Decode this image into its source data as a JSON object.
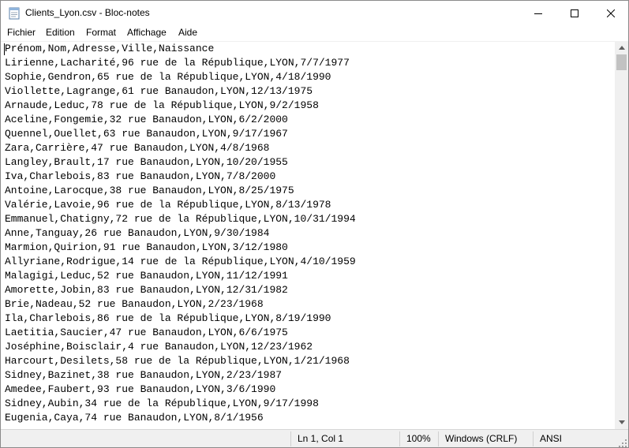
{
  "window": {
    "title": "Clients_Lyon.csv - Bloc-notes"
  },
  "menu": [
    "Fichier",
    "Edition",
    "Format",
    "Affichage",
    "Aide"
  ],
  "editor": {
    "lines": [
      "Prénom,Nom,Adresse,Ville,Naissance",
      "Lirienne,Lacharité,96 rue de la République,LYON,7/7/1977",
      "Sophie,Gendron,65 rue de la République,LYON,4/18/1990",
      "Viollette,Lagrange,61 rue Banaudon,LYON,12/13/1975",
      "Arnaude,Leduc,78 rue de la République,LYON,9/2/1958",
      "Aceline,Fongemie,32 rue Banaudon,LYON,6/2/2000",
      "Quennel,Ouellet,63 rue Banaudon,LYON,9/17/1967",
      "Zara,Carrière,47 rue Banaudon,LYON,4/8/1968",
      "Langley,Brault,17 rue Banaudon,LYON,10/20/1955",
      "Iva,Charlebois,83 rue Banaudon,LYON,7/8/2000",
      "Antoine,Larocque,38 rue Banaudon,LYON,8/25/1975",
      "Valérie,Lavoie,96 rue de la République,LYON,8/13/1978",
      "Emmanuel,Chatigny,72 rue de la République,LYON,10/31/1994",
      "Anne,Tanguay,26 rue Banaudon,LYON,9/30/1984",
      "Marmion,Quirion,91 rue Banaudon,LYON,3/12/1980",
      "Allyriane,Rodrigue,14 rue de la République,LYON,4/10/1959",
      "Malagigi,Leduc,52 rue Banaudon,LYON,11/12/1991",
      "Amorette,Jobin,83 rue Banaudon,LYON,12/31/1982",
      "Brie,Nadeau,52 rue Banaudon,LYON,2/23/1968",
      "Ila,Charlebois,86 rue de la République,LYON,8/19/1990",
      "Laetitia,Saucier,47 rue Banaudon,LYON,6/6/1975",
      "Joséphine,Boisclair,4 rue Banaudon,LYON,12/23/1962",
      "Harcourt,Desilets,58 rue de la République,LYON,1/21/1968",
      "Sidney,Bazinet,38 rue Banaudon,LYON,2/23/1987",
      "Amedee,Faubert,93 rue Banaudon,LYON,3/6/1990",
      "Sidney,Aubin,34 rue de la République,LYON,9/17/1998",
      "Eugenia,Caya,74 rue Banaudon,LYON,8/1/1956"
    ]
  },
  "status": {
    "position": "Ln 1, Col 1",
    "zoom": "100%",
    "line_ending": "Windows (CRLF)",
    "encoding": "ANSI"
  },
  "icons": {
    "app": "notepad-icon",
    "minimize": "minimize-icon",
    "maximize": "maximize-icon",
    "close": "close-icon",
    "scroll_up": "scroll-up-arrow-icon",
    "scroll_down": "scroll-down-arrow-icon",
    "resize": "resize-grip-icon"
  }
}
